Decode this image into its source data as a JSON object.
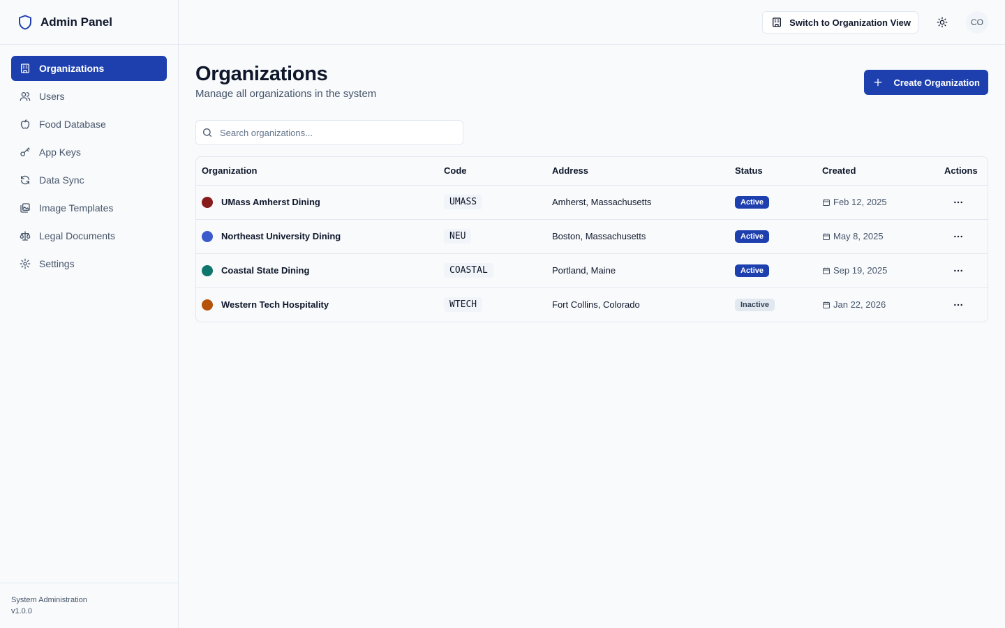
{
  "brand": {
    "title": "Admin Panel",
    "icon": "shield-icon"
  },
  "sidebar": {
    "items": [
      {
        "label": "Organizations",
        "icon": "building-icon",
        "active": true
      },
      {
        "label": "Users",
        "icon": "users-icon"
      },
      {
        "label": "Food Database",
        "icon": "apple-icon"
      },
      {
        "label": "App Keys",
        "icon": "key-icon"
      },
      {
        "label": "Data Sync",
        "icon": "refresh-icon"
      },
      {
        "label": "Image Templates",
        "icon": "images-icon"
      },
      {
        "label": "Legal Documents",
        "icon": "scale-icon"
      },
      {
        "label": "Settings",
        "icon": "gear-icon"
      }
    ],
    "footer": {
      "line1": "System Administration",
      "line2": "v1.0.0"
    }
  },
  "topbar": {
    "switch_label": "Switch to Organization View",
    "avatar_initials": "CO"
  },
  "page": {
    "title": "Organizations",
    "subtitle": "Manage all organizations in the system",
    "create_label": "Create Organization"
  },
  "search": {
    "placeholder": "Search organizations...",
    "value": ""
  },
  "table": {
    "columns": [
      "Organization",
      "Code",
      "Address",
      "Status",
      "Created",
      "Actions"
    ],
    "rows": [
      {
        "name": "UMass Amherst Dining",
        "color": "#881c1c",
        "code": "UMASS",
        "address": "Amherst, Massachusetts",
        "status": "Active",
        "created": "Feb 12, 2025"
      },
      {
        "name": "Northeast University Dining",
        "color": "#3b5bcc",
        "code": "NEU",
        "address": "Boston, Massachusetts",
        "status": "Active",
        "created": "May 8, 2025"
      },
      {
        "name": "Coastal State Dining",
        "color": "#0f766e",
        "code": "COASTAL",
        "address": "Portland, Maine",
        "status": "Active",
        "created": "Sep 19, 2025"
      },
      {
        "name": "Western Tech Hospitality",
        "color": "#b45309",
        "code": "WTECH",
        "address": "Fort Collins, Colorado",
        "status": "Inactive",
        "created": "Jan 22, 2026"
      }
    ]
  },
  "colors": {
    "primary": "#1e40af",
    "border": "#e2e8f0",
    "muted_text": "#475569"
  }
}
